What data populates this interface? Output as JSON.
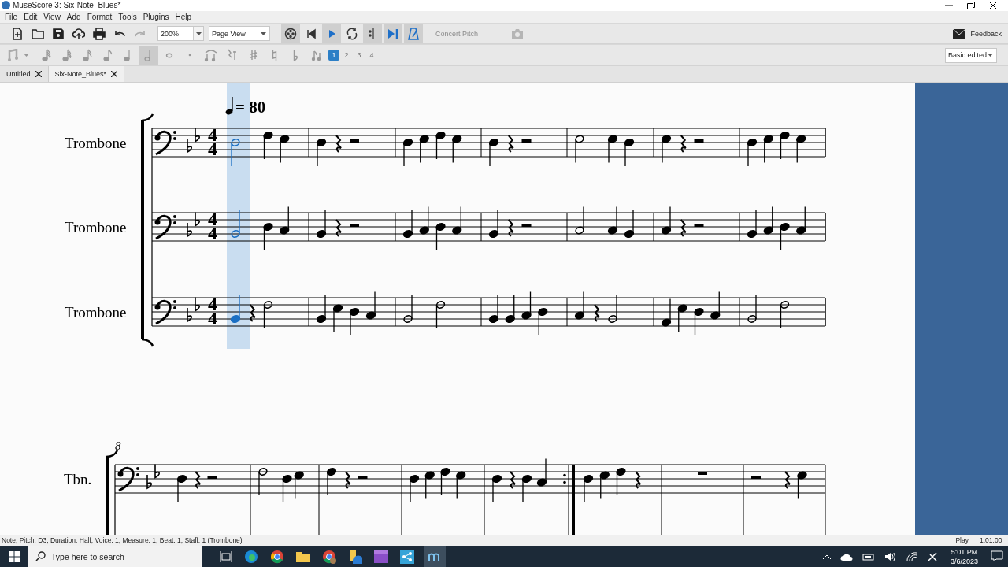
{
  "window": {
    "title": "MuseScore 3: Six-Note_Blues*"
  },
  "menu": [
    "File",
    "Edit",
    "View",
    "Add",
    "Format",
    "Tools",
    "Plugins",
    "Help"
  ],
  "file_tools": [
    {
      "kind": "new",
      "disabled": false
    },
    {
      "kind": "open",
      "disabled": false
    },
    {
      "kind": "save",
      "disabled": false
    },
    {
      "kind": "upload",
      "disabled": false
    },
    {
      "kind": "print",
      "disabled": false
    },
    {
      "kind": "undo",
      "disabled": false
    },
    {
      "kind": "redo",
      "disabled": true
    }
  ],
  "zoom": {
    "value": "200%"
  },
  "view_mode": {
    "value": "Page View"
  },
  "playback": [
    {
      "kind": "mixer",
      "on": true
    },
    {
      "kind": "rewind",
      "on": false
    },
    {
      "kind": "play",
      "on": true
    },
    {
      "kind": "loop",
      "on": false
    },
    {
      "kind": "pan",
      "on": true
    },
    {
      "kind": "repeats",
      "on": true
    },
    {
      "kind": "metronome",
      "on": true
    }
  ],
  "concert_pitch": {
    "label": "Concert Pitch",
    "disabled": true
  },
  "image_capture": {
    "disabled": true
  },
  "feedback": {
    "label": "Feedback"
  },
  "durations": [
    {
      "kind": "n64",
      "selected": false
    },
    {
      "kind": "n32",
      "selected": false
    },
    {
      "kind": "n16",
      "selected": false
    },
    {
      "kind": "n8",
      "selected": false
    },
    {
      "kind": "n4",
      "selected": false
    },
    {
      "kind": "n2",
      "selected": true
    },
    {
      "kind": "n1",
      "selected": false
    },
    {
      "kind": "dot",
      "selected": false
    }
  ],
  "note_tools": [
    {
      "kind": "tie"
    },
    {
      "kind": "rest"
    },
    {
      "kind": "sharp"
    },
    {
      "kind": "natural"
    },
    {
      "kind": "flat"
    },
    {
      "kind": "flip"
    }
  ],
  "voices": [
    {
      "label": "1",
      "selected": true
    },
    {
      "label": "2",
      "selected": false
    },
    {
      "label": "3",
      "selected": false
    },
    {
      "label": "4",
      "selected": false
    }
  ],
  "workspace": {
    "value": "Basic edited"
  },
  "tabs": [
    {
      "label": "Untitled",
      "selected": false
    },
    {
      "label": "Six-Note_Blues*",
      "selected": true
    }
  ],
  "score": {
    "tempo": "= 80",
    "systems": [
      {
        "staves": [
          {
            "name": "Trombone",
            "time_signature": [
              "4",
              "4"
            ]
          },
          {
            "name": "Trombone",
            "time_signature": [
              "4",
              "4"
            ]
          },
          {
            "name": "Trombone",
            "time_signature": [
              "4",
              "4"
            ]
          }
        ]
      },
      {
        "measure_number": "8",
        "staves": [
          {
            "name": "Tbn."
          }
        ]
      }
    ]
  },
  "status_bar": {
    "text": "Note; Pitch: D3; Duration: Half; Voice: 1;  Measure: 1; Beat: 1; Staff: 1 (Trombone)",
    "mode": "Play",
    "time": "1:01:00"
  },
  "taskbar": {
    "search_placeholder": "Type here to search",
    "time": "5:01 PM",
    "date": "3/6/2023"
  }
}
